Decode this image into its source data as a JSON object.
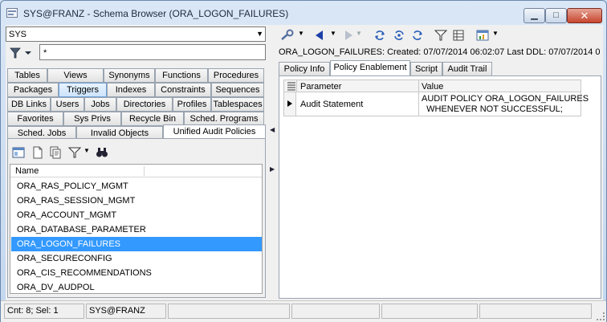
{
  "window": {
    "title": "SYS@FRANZ - Schema Browser (ORA_LOGON_FAILURES)",
    "controls": {
      "minimize": "▁",
      "maximize": "□",
      "close": "✕"
    }
  },
  "left": {
    "schema_value": "SYS",
    "filter_value": "*",
    "tab_rows": [
      [
        "Tables",
        "Views",
        "Synonyms",
        "Functions",
        "Procedures"
      ],
      [
        "Packages",
        "Triggers",
        "Indexes",
        "Constraints",
        "Sequences"
      ],
      [
        "DB Links",
        "Users",
        "Jobs",
        "Directories",
        "Profiles",
        "Tablespaces"
      ],
      [
        "Favorites",
        "Sys Privs",
        "Recycle Bin",
        "Sched. Programs"
      ],
      [
        "Sched. Jobs",
        "Invalid Objects",
        "Unified Audit Policies"
      ]
    ],
    "list_header": "Name",
    "items": [
      "ORA_RAS_POLICY_MGMT",
      "ORA_RAS_SESSION_MGMT",
      "ORA_ACCOUNT_MGMT",
      "ORA_DATABASE_PARAMETER",
      "ORA_LOGON_FAILURES",
      "ORA_SECURECONFIG",
      "ORA_CIS_RECOMMENDATIONS",
      "ORA_DV_AUDPOL"
    ],
    "selected_item": "ORA_LOGON_FAILURES"
  },
  "right": {
    "info": "ORA_LOGON_FAILURES:  Created: 07/07/2014 06:02:07   Last DDL: 07/07/2014 0",
    "tabs": [
      "Policy Info",
      "Policy Enablement",
      "Script",
      "Audit Trail"
    ],
    "active_tab": "Policy Enablement",
    "grid": {
      "col_param": "Parameter",
      "col_value": "Value",
      "row_param": "Audit Statement",
      "row_value": "AUDIT POLICY ORA_LOGON_FAILURES\n  WHENEVER NOT SUCCESSFUL;"
    }
  },
  "status": {
    "count": "Cnt: 8; Sel: 1",
    "connection": "SYS@FRANZ"
  }
}
